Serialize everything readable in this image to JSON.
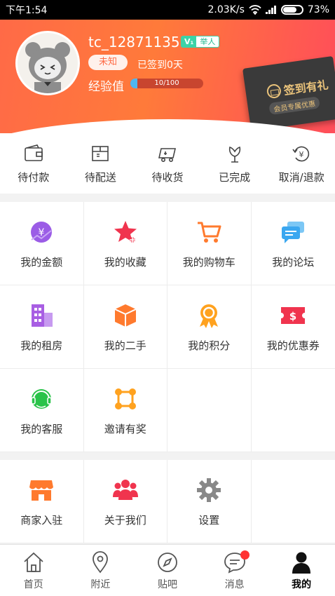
{
  "status_bar": {
    "time": "下午1:54",
    "speed": "2.03K/s",
    "battery": "73%",
    "battery_level": 0.73
  },
  "profile": {
    "username": "tc_12871135",
    "vip_level": "V₁",
    "vip_title": "举人",
    "gender": "未知",
    "checkin_days": "已签到0天",
    "exp_label": "经验值",
    "exp_text": "10/100",
    "exp_progress": 0.1
  },
  "checkin_card": {
    "title": "签到有礼",
    "subtitle": "会员专属优惠"
  },
  "orders": [
    {
      "label": "待付款",
      "icon": "wallet-icon"
    },
    {
      "label": "待配送",
      "icon": "package-icon"
    },
    {
      "label": "待收货",
      "icon": "truck-icon"
    },
    {
      "label": "已完成",
      "icon": "flower-icon"
    },
    {
      "label": "取消/退款",
      "icon": "refund-icon"
    }
  ],
  "grid_a": [
    {
      "label": "我的金额",
      "icon": "money-icon",
      "color": "#9b5ce6"
    },
    {
      "label": "我的收藏",
      "icon": "star-icon",
      "color": "#f0344e"
    },
    {
      "label": "我的购物车",
      "icon": "cart-icon",
      "color": "#ff7a2e"
    },
    {
      "label": "我的论坛",
      "icon": "chat-icon",
      "color": "#3aa7f0"
    },
    {
      "label": "我的租房",
      "icon": "building-icon",
      "color": "#a85ee3"
    },
    {
      "label": "我的二手",
      "icon": "box-icon",
      "color": "#ff7a2e"
    },
    {
      "label": "我的积分",
      "icon": "medal-icon",
      "color": "#ffa21f"
    },
    {
      "label": "我的优惠券",
      "icon": "coupon-icon",
      "color": "#f0344e"
    },
    {
      "label": "我的客服",
      "icon": "headset-icon",
      "color": "#2ac34a"
    },
    {
      "label": "邀请有奖",
      "icon": "network-icon",
      "color": "#ffa21f"
    }
  ],
  "grid_b": [
    {
      "label": "商家入驻",
      "icon": "shop-icon",
      "color": "#ff7a2e"
    },
    {
      "label": "关于我们",
      "icon": "group-icon",
      "color": "#f0344e"
    },
    {
      "label": "设置",
      "icon": "gear-icon",
      "color": "#888888"
    }
  ],
  "tabbar": [
    {
      "label": "首页",
      "icon": "home-icon"
    },
    {
      "label": "附近",
      "icon": "location-icon"
    },
    {
      "label": "贴吧",
      "icon": "compass-icon"
    },
    {
      "label": "消息",
      "icon": "message-icon"
    },
    {
      "label": "我的",
      "icon": "person-icon"
    }
  ]
}
